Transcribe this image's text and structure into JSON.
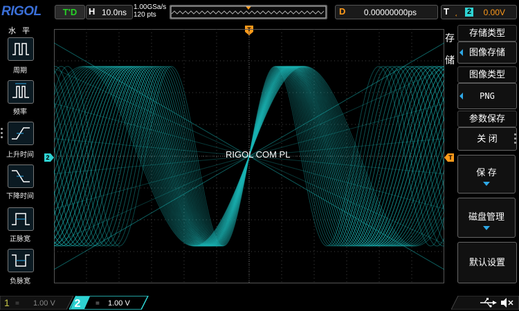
{
  "top": {
    "logo": "RIGOL",
    "trigger_state": "T'D",
    "horizontal_key": "H",
    "timebase": "10.0ns",
    "sample_rate": "1.00GSa/s",
    "memory_depth": "120 pts",
    "delay_key": "D",
    "delay": "0.00000000ps",
    "trigger_key": "T",
    "trigger_source": "2",
    "trigger_level": "0.00V",
    "trigger_level_color": "#ff9a1a"
  },
  "left_menu": {
    "title": "水 平",
    "items": [
      {
        "label": "周期",
        "icon": "period-measure-icon"
      },
      {
        "label": "频率",
        "icon": "frequency-measure-icon"
      },
      {
        "label": "上升时间",
        "icon": "rise-time-icon"
      },
      {
        "label": "下降时间",
        "icon": "fall-time-icon"
      },
      {
        "label": "正脉宽",
        "icon": "positive-width-icon"
      },
      {
        "label": "负脉宽",
        "icon": "negative-width-icon"
      }
    ]
  },
  "screen": {
    "watermark": "RIGOL COM PL",
    "channel_marker": "2",
    "trigger_marker": "T",
    "trace_color": "#1ab3b3"
  },
  "right_menu": {
    "section_side": [
      "存",
      "储"
    ],
    "storage_type_title": "存储类型",
    "storage_type_value": "图像存储",
    "image_type_title": "图像类型",
    "image_type_value": "PNG",
    "param_save_title": "参数保存",
    "param_save_value": "关 闭",
    "save_label": "保 存",
    "disk_label": "磁盘管理",
    "default_label": "默认设置"
  },
  "bottom": {
    "ch1_num": "1",
    "ch1_coupling": "=",
    "ch1_scale": "1.00 V",
    "ch2_num": "2",
    "ch2_coupling": "=",
    "ch2_scale": "1.00 V",
    "ch1_color": "#c8c84a",
    "ch2_color": "#2ed3d3"
  }
}
